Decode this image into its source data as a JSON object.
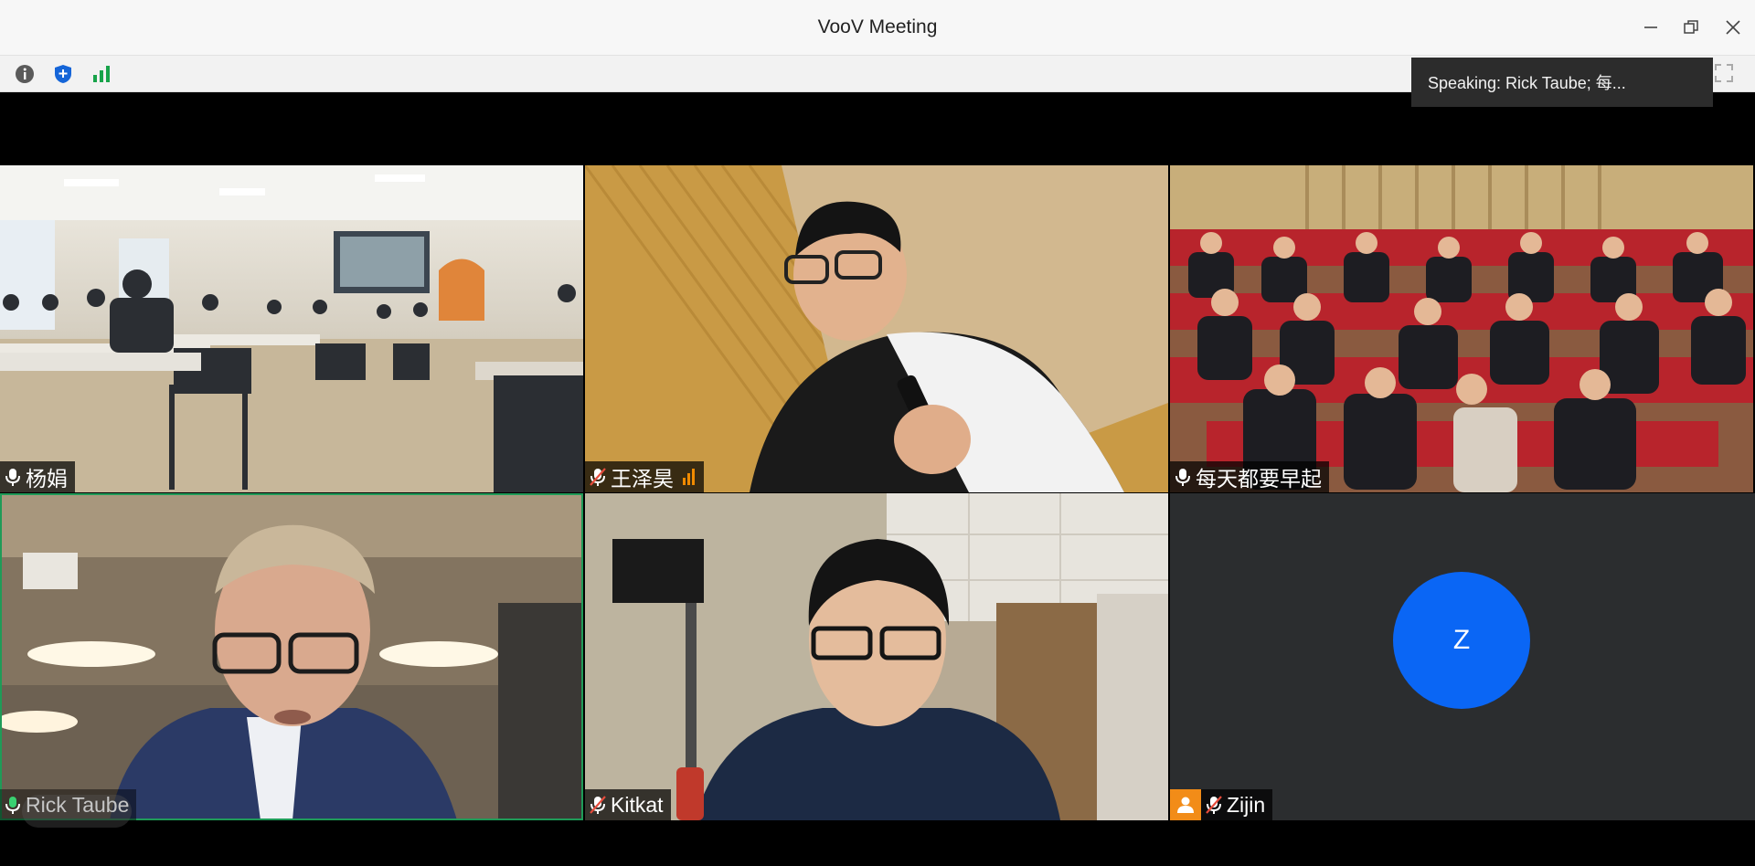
{
  "window": {
    "title": "VooV Meeting"
  },
  "toolbar": {
    "icons": [
      "info-icon",
      "shield-icon",
      "signal-icon"
    ]
  },
  "speaking": {
    "text": "Speaking: Rick Taube; 每..."
  },
  "participants": [
    {
      "name": "杨娟",
      "mic": "on",
      "scene": "classroom"
    },
    {
      "name": "王泽昊",
      "mic": "muted",
      "scene": "student-with-microphone"
    },
    {
      "name": "每天都要早起",
      "mic": "on",
      "scene": "auditorium-audience"
    },
    {
      "name": "Rick Taube",
      "mic": "on",
      "scene": "speaker-in-room",
      "active": true
    },
    {
      "name": "Kitkat",
      "mic": "muted",
      "scene": "person-in-office"
    },
    {
      "name": "Zijin",
      "mic": "muted",
      "scene": "no-video",
      "avatar_letter": "Z"
    }
  ],
  "colors": {
    "active_border": "#1f9b58",
    "avatar_bg": "#0a66f5",
    "shield": "#1565d8",
    "signal": "#18a34a"
  }
}
